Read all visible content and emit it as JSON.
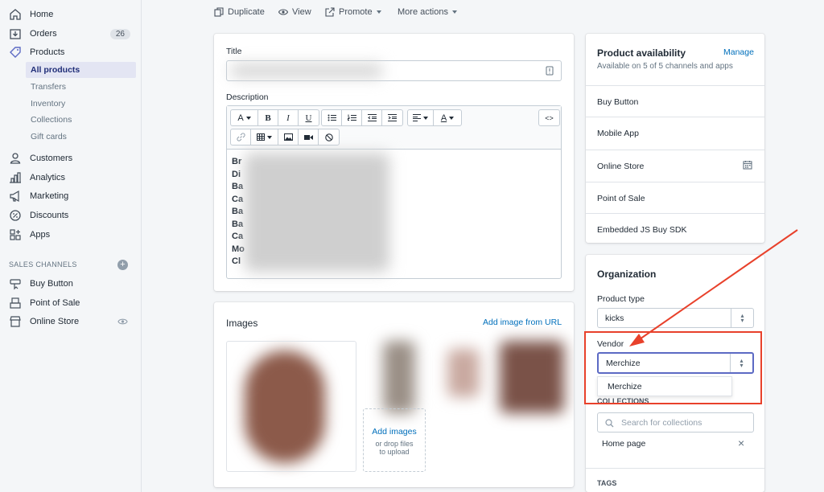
{
  "sidebar": {
    "items": [
      {
        "label": "Home",
        "icon": "home-icon"
      },
      {
        "label": "Orders",
        "icon": "orders-icon",
        "badge": "26"
      },
      {
        "label": "Products",
        "icon": "tag-icon"
      },
      {
        "label": "Customers",
        "icon": "customer-icon"
      },
      {
        "label": "Analytics",
        "icon": "analytics-icon"
      },
      {
        "label": "Marketing",
        "icon": "megaphone-icon"
      },
      {
        "label": "Discounts",
        "icon": "discount-icon"
      },
      {
        "label": "Apps",
        "icon": "apps-icon"
      }
    ],
    "product_subitems": [
      "All products",
      "Transfers",
      "Inventory",
      "Collections",
      "Gift cards"
    ],
    "sales_channels_heading": "SALES CHANNELS",
    "channels": [
      {
        "label": "Buy Button",
        "icon": "buy-button-icon"
      },
      {
        "label": "Point of Sale",
        "icon": "pos-icon"
      },
      {
        "label": "Online Store",
        "icon": "store-icon"
      }
    ]
  },
  "actions": {
    "duplicate": "Duplicate",
    "view": "View",
    "promote": "Promote",
    "more": "More actions"
  },
  "product": {
    "title_label": "Title",
    "description_label": "Description",
    "description_lines": [
      "Br",
      "Di",
      "Ba",
      "Ca",
      "Ba",
      "Ba",
      "Ca",
      "Mo",
      "Cl"
    ]
  },
  "images": {
    "heading": "Images",
    "add_from_url": "Add image from URL",
    "add_images": "Add images",
    "drop_hint_1": "or drop files",
    "drop_hint_2": "to upload"
  },
  "availability": {
    "heading": "Product availability",
    "manage": "Manage",
    "subtext": "Available on 5 of 5 channels and apps",
    "channels": [
      "Buy Button",
      "Mobile App",
      "Online Store",
      "Point of Sale",
      "Embedded JS Buy SDK"
    ]
  },
  "organization": {
    "heading": "Organization",
    "product_type_label": "Product type",
    "product_type_value": "kicks",
    "vendor_label": "Vendor",
    "vendor_value": "Merchize",
    "vendor_suggestion": "Merchize",
    "collections_label": "COLLECTIONS",
    "collections_placeholder": "Search for collections",
    "collection_item": "Home page",
    "tags_label": "TAGS"
  },
  "colors": {
    "accent": "#006fbb",
    "annotation": "#e8412b"
  }
}
